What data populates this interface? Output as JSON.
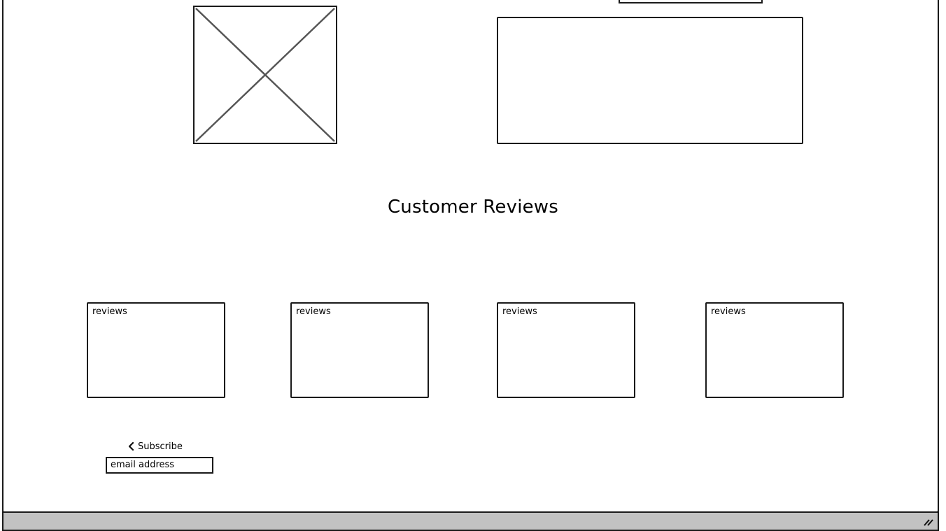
{
  "section": {
    "title": "Customer Reviews"
  },
  "reviews": [
    {
      "label": "reviews"
    },
    {
      "label": "reviews"
    },
    {
      "label": "reviews"
    },
    {
      "label": "reviews"
    }
  ],
  "subscribe": {
    "label": "Subscribe",
    "icon": "chevron-left-icon",
    "email_value": "email address"
  },
  "colors": {
    "stroke": "#1a1a1a",
    "status_bar": "#c2c2c2",
    "placeholder_cross": "#555555"
  }
}
